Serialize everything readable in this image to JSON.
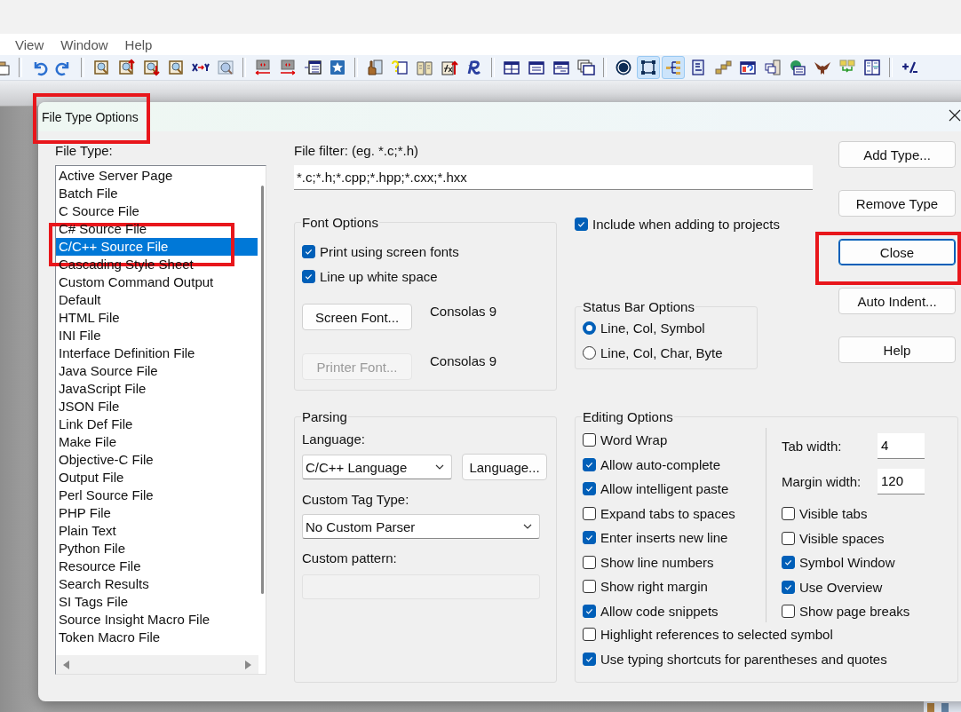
{
  "menu": [
    {
      "label": "View"
    },
    {
      "label": "Window"
    },
    {
      "label": "Help"
    }
  ],
  "toolbar": [
    {
      "pressed": false
    },
    {
      "pressed": false
    },
    {
      "pressed": false
    },
    {
      "pressed": false
    },
    {
      "pressed": false
    },
    {
      "pressed": false
    },
    {
      "pressed": false
    },
    {
      "pressed": false
    },
    {
      "pressed": false
    },
    {
      "pressed": false
    },
    {
      "pressed": false
    },
    {
      "pressed": false
    },
    {
      "pressed": false
    },
    {
      "pressed": false
    },
    {
      "pressed": false
    },
    {
      "pressed": false
    },
    {
      "pressed": false
    },
    {
      "pressed": false
    },
    {
      "pressed": false
    },
    {
      "pressed": false
    },
    {
      "pressed": false
    },
    {
      "pressed": false
    },
    {
      "pressed": false
    },
    {
      "pressed": true
    },
    {
      "pressed": true
    },
    {
      "pressed": false
    },
    {
      "pressed": false
    },
    {
      "pressed": false
    },
    {
      "pressed": false
    },
    {
      "pressed": false
    },
    {
      "pressed": false
    },
    {
      "pressed": false
    },
    {
      "pressed": false
    },
    {
      "pressed": false
    }
  ],
  "dialog": {
    "title": "File Type Options",
    "file_type": {
      "label": "File Type:",
      "items": [
        {
          "label": "Active Server Page",
          "selected": false
        },
        {
          "label": "Batch File",
          "selected": false
        },
        {
          "label": "C Source File",
          "selected": false
        },
        {
          "label": "C# Source File",
          "selected": false
        },
        {
          "label": "C/C++ Source File",
          "selected": true
        },
        {
          "label": "Cascading Style Sheet",
          "selected": false
        },
        {
          "label": "Custom Command Output",
          "selected": false
        },
        {
          "label": "Default",
          "selected": false
        },
        {
          "label": "HTML File",
          "selected": false
        },
        {
          "label": "INI File",
          "selected": false
        },
        {
          "label": "Interface Definition File",
          "selected": false
        },
        {
          "label": "Java Source File",
          "selected": false
        },
        {
          "label": "JavaScript File",
          "selected": false
        },
        {
          "label": "JSON File",
          "selected": false
        },
        {
          "label": "Link Def File",
          "selected": false
        },
        {
          "label": "Make File",
          "selected": false
        },
        {
          "label": "Objective-C File",
          "selected": false
        },
        {
          "label": "Output File",
          "selected": false
        },
        {
          "label": "Perl Source File",
          "selected": false
        },
        {
          "label": "PHP File",
          "selected": false
        },
        {
          "label": "Plain Text",
          "selected": false
        },
        {
          "label": "Python File",
          "selected": false
        },
        {
          "label": "Resource File",
          "selected": false
        },
        {
          "label": "Search Results",
          "selected": false
        },
        {
          "label": "SI Tags File",
          "selected": false
        },
        {
          "label": "Source Insight Macro File",
          "selected": false
        },
        {
          "label": "Token Macro File",
          "selected": false
        }
      ]
    },
    "file_filter": {
      "label": "File filter: (eg. *.c;*.h)",
      "value": "*.c;*.h;*.cpp;*.hpp;*.cxx;*.hxx"
    },
    "font_options": {
      "title": "Font Options",
      "checkboxes": [
        {
          "label": "Print using screen fonts",
          "checked": true
        },
        {
          "label": "Line up white space",
          "checked": true
        }
      ],
      "fonts": [
        {
          "button": "Screen Font...",
          "disabled": false,
          "font": "Consolas 9"
        },
        {
          "button": "Printer Font...",
          "disabled": true,
          "font": "Consolas 9"
        }
      ]
    },
    "include_in_projects": {
      "label": "Include when adding to projects",
      "checked": true
    },
    "status_bar_options": {
      "title": "Status Bar Options",
      "radios": [
        {
          "label": "Line, Col, Symbol",
          "selected": true
        },
        {
          "label": "Line, Col, Char, Byte",
          "selected": false
        }
      ]
    },
    "parsing": {
      "title": "Parsing",
      "language_label": "Language:",
      "language": "C/C++ Language",
      "language_button": "Language...",
      "tag_label": "Custom Tag Type:",
      "tag_type": "No Custom Parser",
      "pattern_label": "Custom pattern:"
    },
    "editing_options": {
      "title": "Editing Options",
      "left": [
        {
          "label": "Word Wrap",
          "checked": false
        },
        {
          "label": "Allow auto-complete",
          "checked": true
        },
        {
          "label": "Allow intelligent paste",
          "checked": true
        },
        {
          "label": "Expand tabs to spaces",
          "checked": false
        },
        {
          "label": "Enter inserts new line",
          "checked": true
        },
        {
          "label": "Show line numbers",
          "checked": false
        },
        {
          "label": "Show right margin",
          "checked": false
        },
        {
          "label": "Allow code snippets",
          "checked": true
        }
      ],
      "fields": [
        {
          "label": "Tab width:",
          "value": "4"
        },
        {
          "label": "Margin width:",
          "value": "120"
        }
      ],
      "right": [
        {
          "label": "Visible tabs",
          "checked": false
        },
        {
          "label": "Visible spaces",
          "checked": false
        },
        {
          "label": "Symbol Window",
          "checked": true
        },
        {
          "label": "Use Overview",
          "checked": true
        },
        {
          "label": "Show page breaks",
          "checked": false
        }
      ],
      "bottom": [
        {
          "label": "Highlight references to selected symbol",
          "checked": false
        },
        {
          "label": "Use typing shortcuts for parentheses and quotes",
          "checked": true
        }
      ]
    },
    "buttons": [
      {
        "label": "Add Type...",
        "focused": false
      },
      {
        "label": "Remove Type",
        "focused": false
      },
      {
        "label": "Close",
        "focused": true
      },
      {
        "label": "Auto Indent...",
        "focused": false
      },
      {
        "label": "Help",
        "focused": false
      }
    ]
  }
}
